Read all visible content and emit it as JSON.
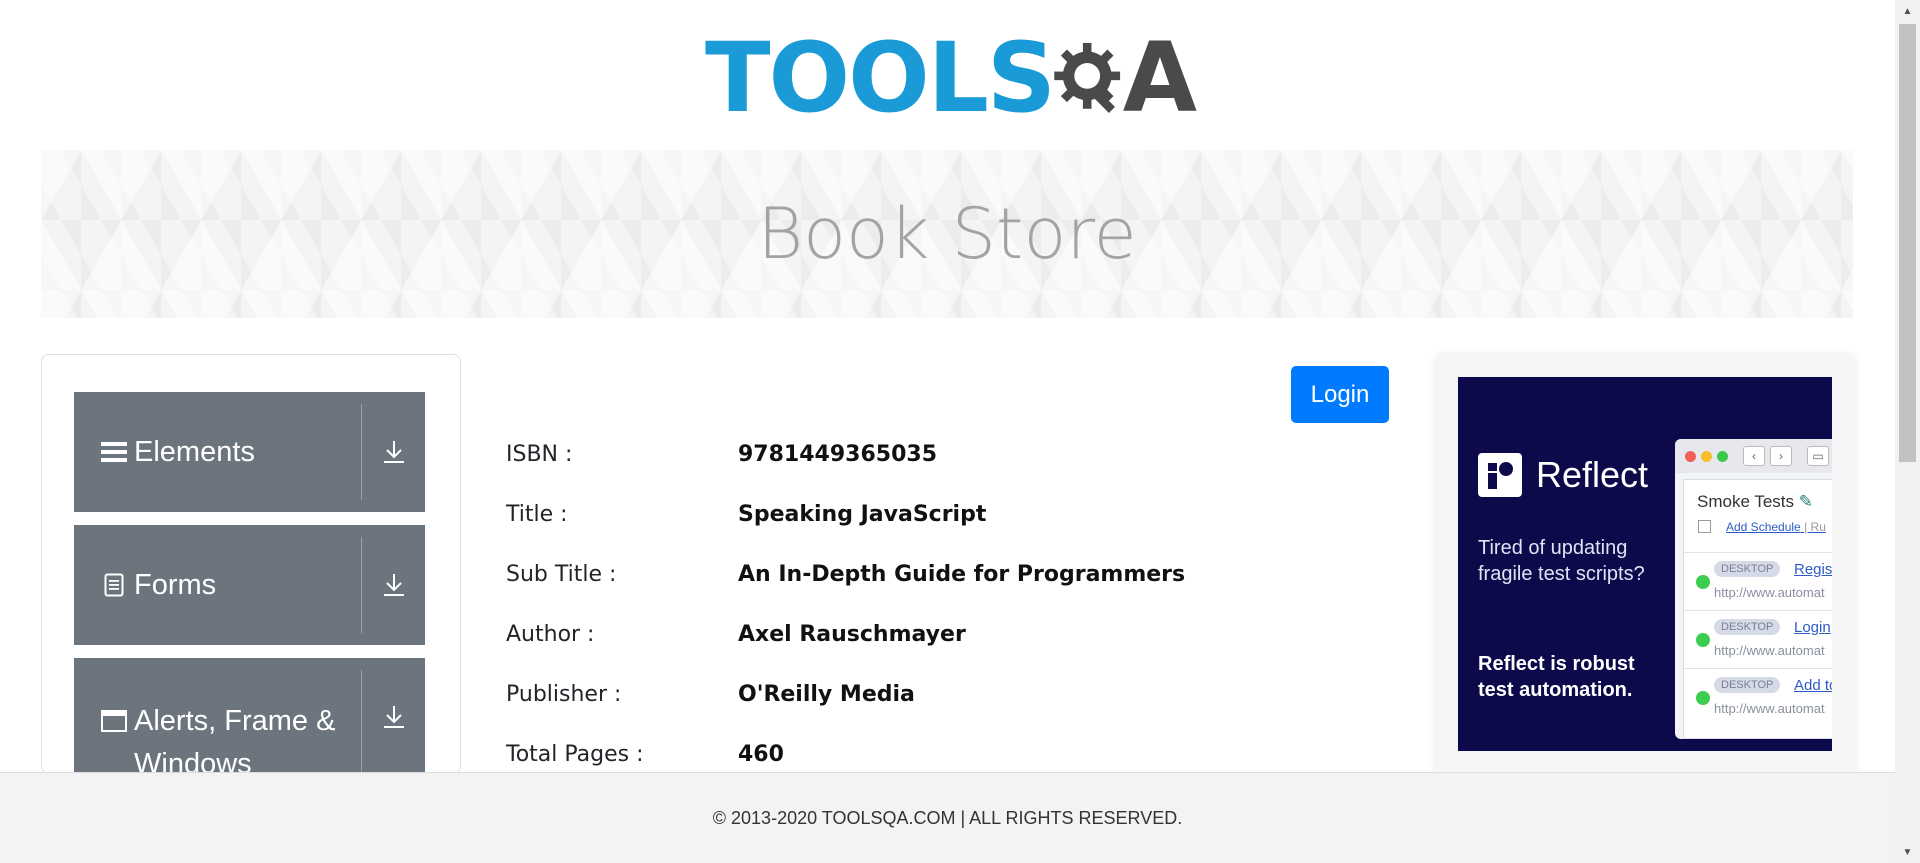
{
  "logo": {
    "tools": "TOOLS",
    "q": "Q",
    "a": "A"
  },
  "banner": {
    "title": "Book Store"
  },
  "sidebar": {
    "groups": [
      {
        "label": "Elements",
        "icon": "hamburger-icon"
      },
      {
        "label": "Forms",
        "icon": "document-icon"
      },
      {
        "label": "Alerts, Frame & Windows",
        "icon": "window-icon"
      }
    ]
  },
  "header": {
    "login_label": "Login"
  },
  "book": {
    "rows": [
      {
        "label": "ISBN :",
        "value": "9781449365035"
      },
      {
        "label": "Title :",
        "value": "Speaking JavaScript"
      },
      {
        "label": "Sub Title :",
        "value": "An In-Depth Guide for Programmers"
      },
      {
        "label": "Author :",
        "value": "Axel Rauschmayer"
      },
      {
        "label": "Publisher :",
        "value": "O'Reilly Media"
      },
      {
        "label": "Total Pages :",
        "value": "460"
      }
    ]
  },
  "ad": {
    "brand": "Reflect",
    "tagline": "Tired of updating fragile test scripts?",
    "strong": "Reflect is robust test automation.",
    "window_title": "Smoke Tests",
    "add_schedule": "Add Schedule",
    "sep": "| Ru",
    "items": [
      {
        "badge": "DESKTOP",
        "link": "Registr",
        "url": "http://www.automat"
      },
      {
        "badge": "DESKTOP",
        "link": "Login",
        "url": "http://www.automat"
      },
      {
        "badge": "DESKTOP",
        "link": "Add to",
        "url": "http://www.automat"
      }
    ]
  },
  "footer": {
    "text": "© 2013-2020 TOOLSQA.COM | ALL RIGHTS RESERVED."
  },
  "colors": {
    "primary": "#007bff",
    "nav_bg": "#6c757d",
    "logo_blue": "#1a9ad6",
    "ad_bg": "#0c0a4a"
  }
}
